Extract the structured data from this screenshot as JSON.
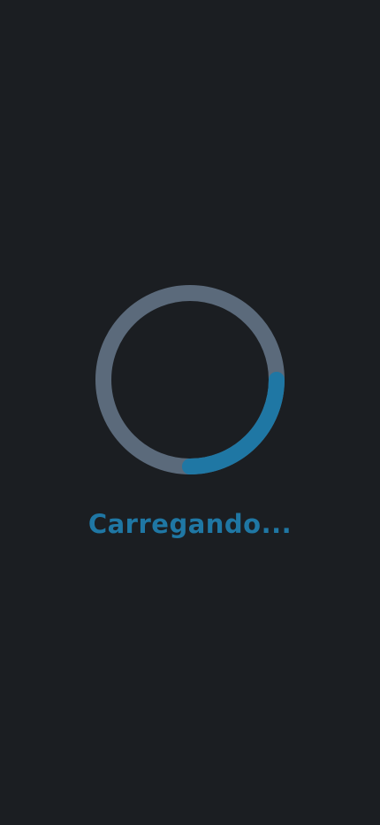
{
  "loader": {
    "label": "Carregando...",
    "progress_fraction": 0.25,
    "colors": {
      "background": "#1b1e22",
      "track": "#5b6a7b",
      "arc": "#1f77a4",
      "label": "#1f77a4"
    }
  }
}
